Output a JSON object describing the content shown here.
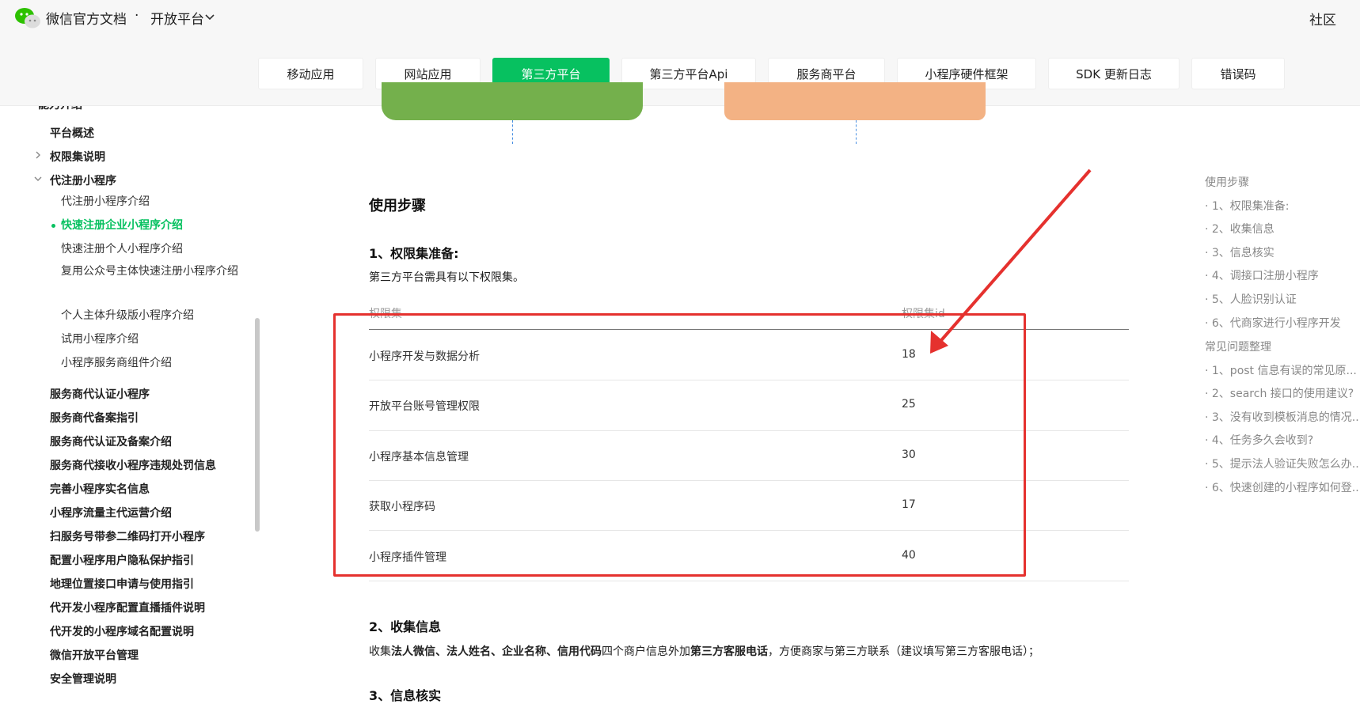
{
  "header": {
    "brand": "微信官方文档",
    "separator": "·",
    "platform": "开放平台",
    "community": "社区"
  },
  "tabs": [
    {
      "label": "移动应用"
    },
    {
      "label": "网站应用"
    },
    {
      "label": "第三方平台"
    },
    {
      "label": "第三方平台Api"
    },
    {
      "label": "服务商平台"
    },
    {
      "label": "小程序硬件框架"
    },
    {
      "label": "SDK 更新日志"
    },
    {
      "label": "错误码"
    }
  ],
  "sidebar": {
    "section_partial": "能力介绍",
    "items": [
      "平台概述",
      "权限集说明",
      "代注册小程序",
      "代注册小程序介绍",
      "快速注册企业小程序介绍",
      "快速注册个人小程序介绍",
      "复用公众号主体快速注册小程序介绍",
      "个人主体升级版小程序介绍",
      "试用小程序介绍",
      "小程序服务商组件介绍",
      "服务商代认证小程序",
      "服务商代备案指引",
      "服务商代认证及备案介绍",
      "服务商代接收小程序违规处罚信息",
      "完善小程序实名信息",
      "小程序流量主代运营介绍",
      "扫服务号带参二维码打开小程序",
      "配置小程序用户隐私保护指引",
      "地理位置接口申请与使用指引",
      "代开发小程序配置直播插件说明",
      "代开发的小程序域名配置说明",
      "微信开放平台管理",
      "安全管理说明"
    ]
  },
  "content": {
    "section_title": "使用步骤",
    "step1_title": "1、权限集准备:",
    "step1_desc": "第三方平台需具有以下权限集。",
    "table": {
      "headers": [
        "权限集",
        "权限集id"
      ],
      "rows": [
        {
          "name": "小程序开发与数据分析",
          "id": "18"
        },
        {
          "name": "开放平台账号管理权限",
          "id": "25"
        },
        {
          "name": "小程序基本信息管理",
          "id": "30"
        },
        {
          "name": "获取小程序码",
          "id": "17"
        },
        {
          "name": "小程序插件管理",
          "id": "40"
        }
      ]
    },
    "step2_title": "2、收集信息",
    "step2_desc": {
      "p1": "收集",
      "b1": "法人微信、法人姓名、企业名称、信用代码",
      "p2": "四个商户信息外加",
      "b2": "第三方客服电话",
      "p3": "，方便商家与第三方联系（建议填写第三方客服电话）；"
    },
    "step3_partial": "3、信息核实"
  },
  "toc": {
    "items": [
      "使用步骤",
      "· 1、权限集准备:",
      "· 2、收集信息",
      "· 3、信息核实",
      "· 4、调接口注册小程序",
      "· 5、人脸识别认证",
      "· 6、代商家进行小程序开发",
      "常见问题整理",
      "· 1、post 信息有误的常见原...",
      "· 2、search 接口的使用建议?",
      "· 3、没有收到模板消息的情况...",
      "· 4、任务多久会收到?",
      "· 5、提示法人验证失败怎么办...",
      "· 6、快速创建的小程序如何登..."
    ]
  },
  "colors": {
    "accent": "#07c160",
    "annotation": "#e5312e"
  }
}
